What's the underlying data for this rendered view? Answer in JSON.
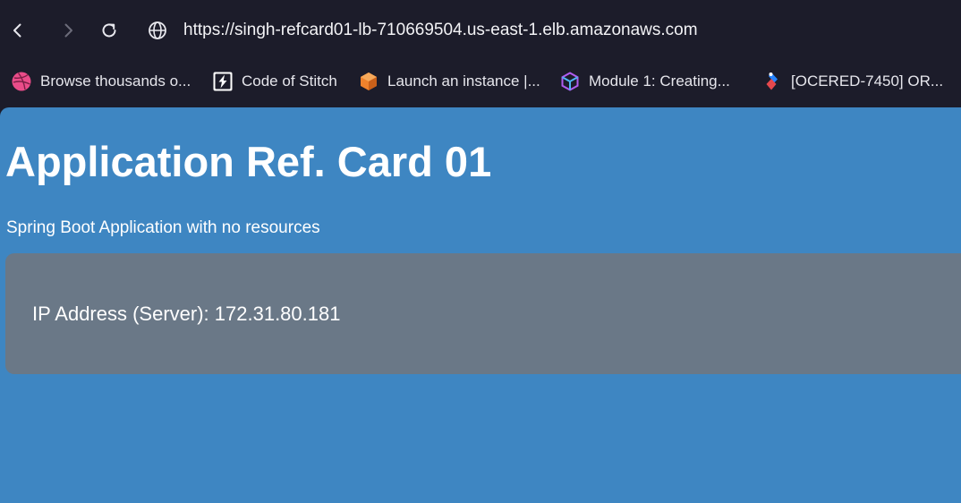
{
  "browser": {
    "url": "https://singh-refcard01-lb-710669504.us-east-1.elb.amazonaws.com",
    "nav": {
      "back": "back-icon",
      "forward": "forward-icon",
      "reload": "reload-icon",
      "site_info": "globe-icon"
    }
  },
  "bookmarks": [
    {
      "label": "Browse thousands o...",
      "icon": "dribbble-icon"
    },
    {
      "label": "Code of Stitch",
      "icon": "stitch-icon"
    },
    {
      "label": "Launch an instance |...",
      "icon": "aws-cube-icon"
    },
    {
      "label": "Module 1: Creating...",
      "icon": "module-cube-icon"
    },
    {
      "label": "[OCERED-7450] OR...",
      "icon": "jira-icon"
    }
  ],
  "page": {
    "title": "Application Ref. Card 01",
    "subtitle": "Spring Boot Application with no resources",
    "card": {
      "ip_text": "IP Address (Server): 172.31.80.181"
    }
  },
  "colors": {
    "chrome_bg": "#1c1c2a",
    "page_bg": "#3e86c2",
    "card_bg": "#6a7887",
    "text": "#ffffff"
  }
}
